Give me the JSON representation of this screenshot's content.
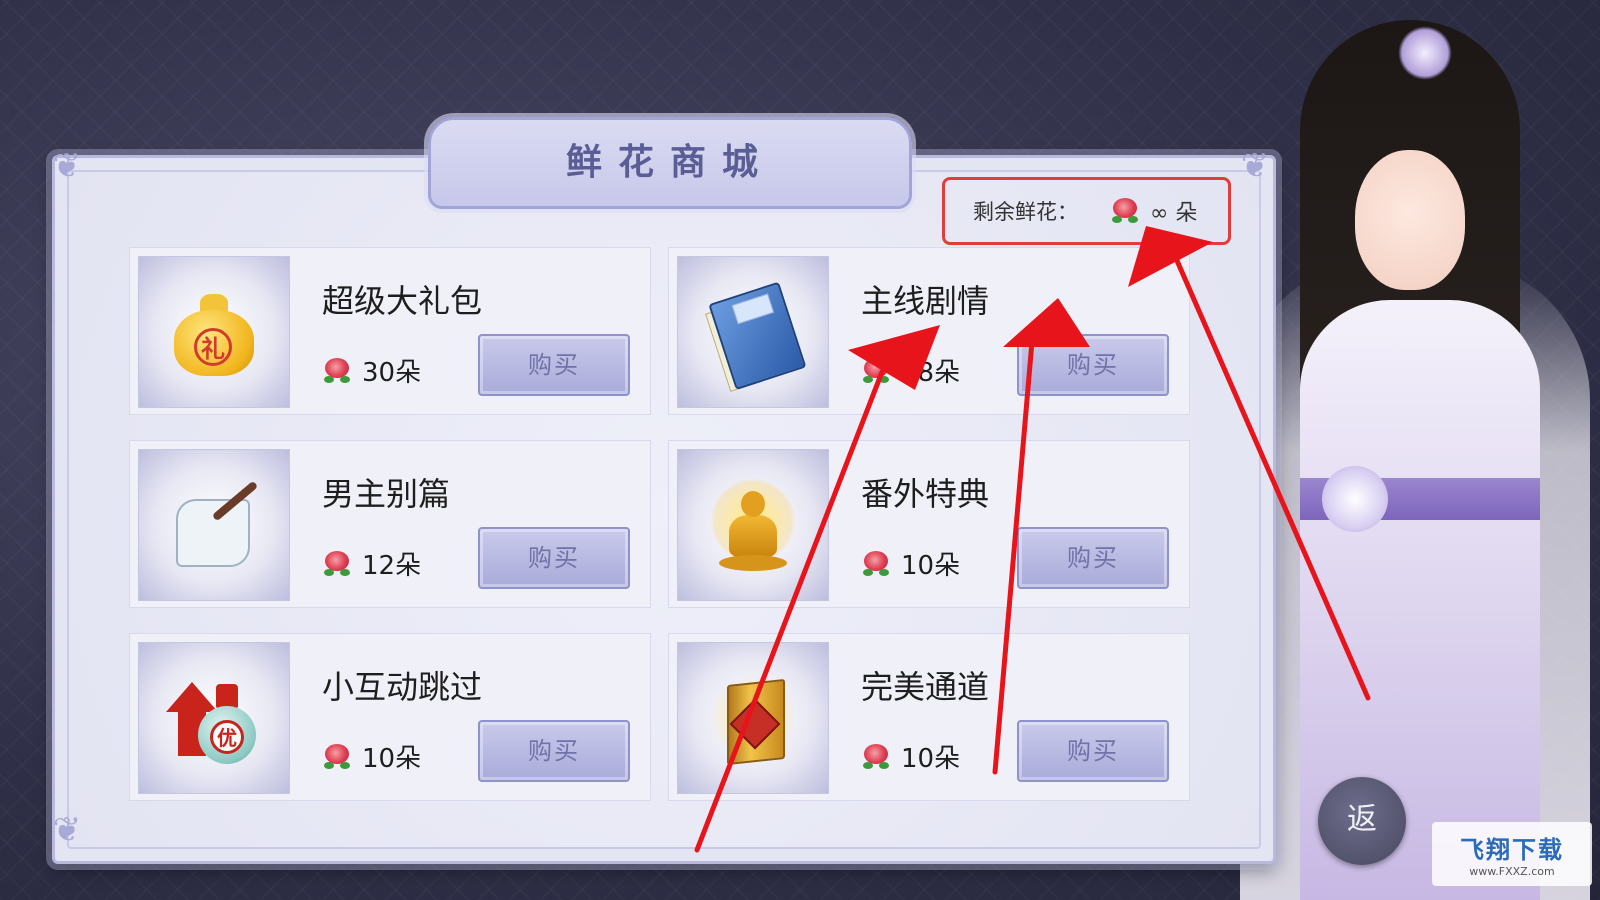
{
  "title": "鲜花商城",
  "remaining": {
    "label": "剩余鲜花：",
    "value": "∞ 朵",
    "icon": "rose-icon"
  },
  "items": [
    {
      "name": "超级大礼包",
      "price": "30朵",
      "buy_label": "购买",
      "icon": "gift-bag-icon",
      "seal": "礼"
    },
    {
      "name": "主线剧情",
      "price": "18朵",
      "buy_label": "购买",
      "icon": "book-icon"
    },
    {
      "name": "男主别篇",
      "price": "12朵",
      "buy_label": "购买",
      "icon": "scroll-brush-icon"
    },
    {
      "name": "番外特典",
      "price": "10朵",
      "buy_label": "购买",
      "icon": "golden-buddha-icon"
    },
    {
      "name": "小互动跳过",
      "price": "10朵",
      "buy_label": "购买",
      "icon": "potion-arrow-icon",
      "seal": "优"
    },
    {
      "name": "完美通道",
      "price": "10朵",
      "buy_label": "购买",
      "icon": "golden-box-icon"
    }
  ],
  "back_button": "返",
  "watermark": {
    "title": "飞翔下载",
    "url": "www.FXXZ.com"
  },
  "colors": {
    "annotation": "#e8141c",
    "panel": "#e4e5f3",
    "title": "#5b5d95",
    "button": "#a9abd9"
  }
}
